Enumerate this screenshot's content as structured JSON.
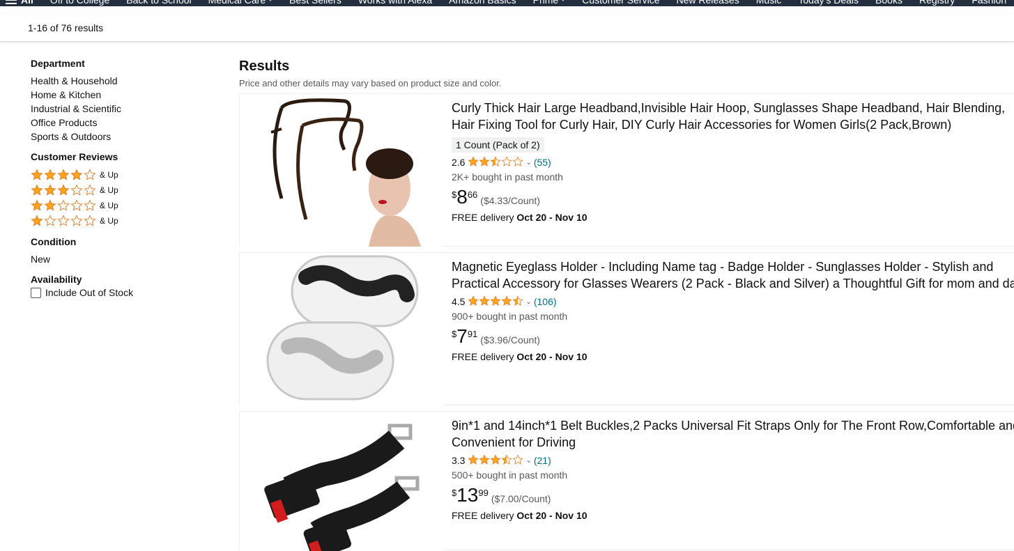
{
  "nav": {
    "all_label": "All",
    "items": [
      "Off to College",
      "Back to School",
      "Medical Care",
      "Best Sellers",
      "Works with Alexa",
      "Amazon Basics",
      "Prime",
      "Customer Service",
      "New Releases",
      "Music",
      "Today's Deals",
      "Books",
      "Registry",
      "Fashion"
    ]
  },
  "results_bar": {
    "count_text": "1-16 of 76 results"
  },
  "sidebar": {
    "department": {
      "heading": "Department",
      "items": [
        "Health & Household",
        "Home & Kitchen",
        "Industrial & Scientific",
        "Office Products",
        "Sports & Outdoors"
      ]
    },
    "reviews": {
      "heading": "Customer Reviews",
      "and_up": "& Up"
    },
    "condition": {
      "heading": "Condition",
      "value": "New"
    },
    "availability": {
      "heading": "Availability",
      "checkbox_label": "Include Out of Stock"
    }
  },
  "main": {
    "title": "Results",
    "subtitle": "Price and other details may vary based on product size and color."
  },
  "products": [
    {
      "title": "Curly Thick Hair Large Headband,Invisible Hair Hoop, Sunglasses Shape Headband, Hair Blending, Hair Fixing Tool for Curly Hair, DIY Curly Hair Accessories for Women Girls(2 Pack,Brown)",
      "variant": "1 Count (Pack of 2)",
      "rating": "2.6",
      "review_count": "(55)",
      "bought": "2K+ bought in past month",
      "price_symbol": "$",
      "price_whole": "8",
      "price_fraction": "66",
      "unit_price": "($4.33/Count)",
      "delivery_prefix": "FREE delivery",
      "delivery_dates": "Oct 20 - Nov 10"
    },
    {
      "title": "Magnetic Eyeglass Holder - Including Name tag - Badge Holder - Sunglasses Holder - Stylish and Practical Accessory for Glasses Wearers (2 Pack - Black and Silver) a Thoughtful Gift for mom and dad",
      "rating": "4.5",
      "review_count": "(106)",
      "bought": "900+ bought in past month",
      "price_symbol": "$",
      "price_whole": "7",
      "price_fraction": "91",
      "unit_price": "($3.96/Count)",
      "delivery_prefix": "FREE delivery",
      "delivery_dates": "Oct 20 - Nov 10"
    },
    {
      "title": "9in*1 and 14inch*1 Belt Buckles,2 Packs Universal Fit Straps Only for The Front Row,Comfortable and Convenient for Driving",
      "rating": "3.3",
      "review_count": "(21)",
      "bought": "500+ bought in past month",
      "price_symbol": "$",
      "price_whole": "13",
      "price_fraction": "99",
      "unit_price": "($7.00/Count)",
      "delivery_prefix": "FREE delivery",
      "delivery_dates": "Oct 20 - Nov 10"
    }
  ],
  "colors": {
    "nav_bg": "#232f3e",
    "star": "#ffa41c",
    "link": "#007185"
  }
}
